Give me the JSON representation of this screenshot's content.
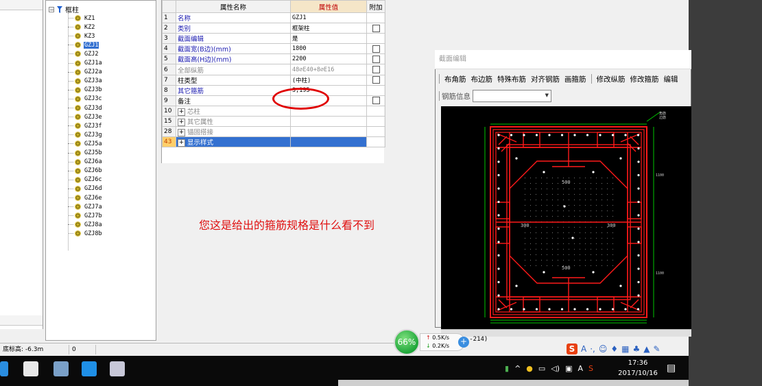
{
  "tree": {
    "root_label": "框柱",
    "items": [
      "KZ1",
      "KZ2",
      "KZ3",
      "GZJ1",
      "GZJ2",
      "GZJ1a",
      "GZJ2a",
      "GZJ3a",
      "GZJ3b",
      "GZJ3c",
      "GZJ3d",
      "GZJ3e",
      "GZJ3f",
      "GZJ3g",
      "GZJ5a",
      "GZJ5b",
      "GZJ6a",
      "GZJ6b",
      "GZJ6c",
      "GZJ6d",
      "GZJ6e",
      "GZJ7a",
      "GZJ7b",
      "GZJ8a",
      "GZJ8b"
    ],
    "selected": "GZJ1"
  },
  "grid": {
    "header_name": "属性名称",
    "header_value": "属性值",
    "header_extra": "附加",
    "rows": [
      {
        "idx": "1",
        "name": "名称",
        "value": "GZJ1",
        "checkbox": false
      },
      {
        "idx": "2",
        "name": "类别",
        "value": "框架柱",
        "checkbox": true
      },
      {
        "idx": "3",
        "name": "截面编辑",
        "value": "是",
        "checkbox": false
      },
      {
        "idx": "4",
        "name": "截面宽(B边)(mm)",
        "value": "1800",
        "checkbox": true
      },
      {
        "idx": "5",
        "name": "截面高(H边)(mm)",
        "value": "2200",
        "checkbox": true
      },
      {
        "idx": "6",
        "name": "全部纵筋",
        "value": "48⌀E40+8⌀E16",
        "checkbox": true
      },
      {
        "idx": "7",
        "name": "柱类型",
        "value": "(中柱)",
        "checkbox": true
      },
      {
        "idx": "8",
        "name": "其它箍筋",
        "value": "3,195",
        "checkbox": false
      },
      {
        "idx": "9",
        "name": "备注",
        "value": "",
        "checkbox": true
      },
      {
        "idx": "10",
        "name": "芯柱",
        "value": "",
        "checkbox": false
      },
      {
        "idx": "15",
        "name": "其它属性",
        "value": "",
        "checkbox": false
      },
      {
        "idx": "28",
        "name": "锚固搭接",
        "value": "",
        "checkbox": false
      },
      {
        "idx": "43",
        "name": "显示样式",
        "value": "",
        "checkbox": false
      }
    ]
  },
  "annotation": "您这是给出的箍筋规格是什么看不到",
  "dialog": {
    "title": "截面编辑",
    "toolbar": [
      "布角筋",
      "布边筋",
      "特殊布筋",
      "对齐钢筋",
      "画箍筋",
      "修改纵筋",
      "修改箍筋",
      "编辑"
    ],
    "info_label": "钢筋信息",
    "canvas_labels": {
      "dim_top": "500",
      "dim_bottom": "500",
      "dim_left": "300",
      "dim_right": "300",
      "side_top": "1100",
      "side_bottom": "1100",
      "legend_1": "角筋",
      "legend_2": "边筋"
    },
    "coord_text": "X: -214)"
  },
  "status": {
    "base_elevation": "底标高: -6.3m",
    "value": "0"
  },
  "speed": {
    "percent": "66%",
    "up": "0.5K/s",
    "down": "0.2K/s"
  },
  "ime": {
    "a_label": "A"
  },
  "tray": {
    "a_label": "A"
  },
  "clock": {
    "time": "17:36",
    "date": "2017/10/16"
  },
  "colors": {
    "rebar": "#ff1a1a",
    "canvas_bg": "#000000",
    "dim_line": "#00c800",
    "selection": "#3370d0",
    "annotation": "#e01010"
  }
}
